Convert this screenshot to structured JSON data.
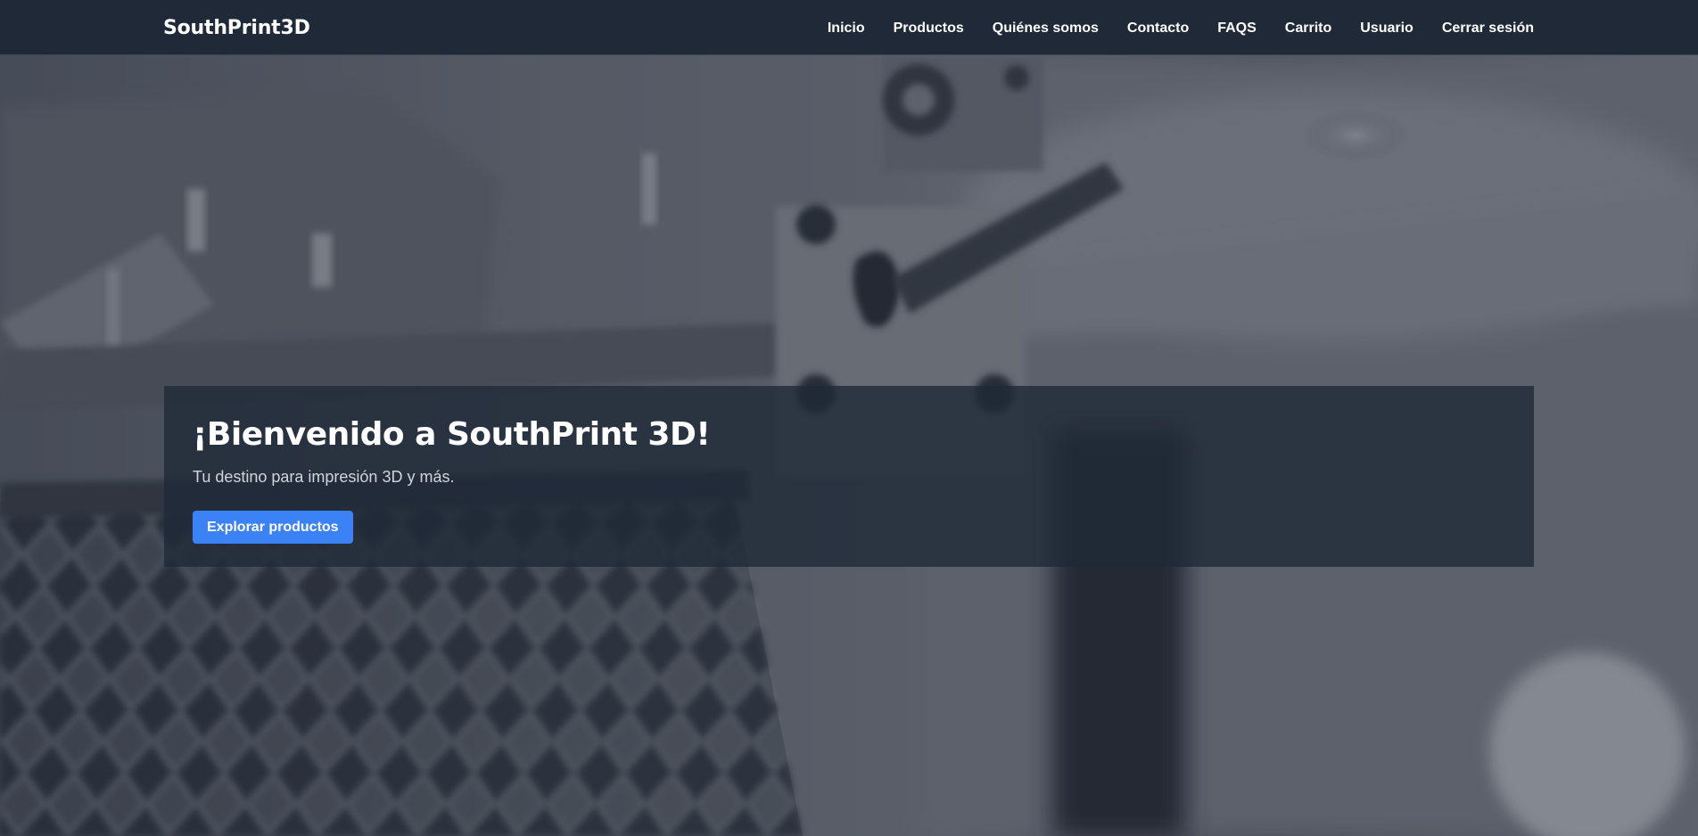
{
  "brand": {
    "name": "SouthPrint3D"
  },
  "nav": {
    "items": [
      {
        "label": "Inicio"
      },
      {
        "label": "Productos"
      },
      {
        "label": "Quiénes somos"
      },
      {
        "label": "Contacto"
      },
      {
        "label": "FAQS"
      },
      {
        "label": "Carrito"
      },
      {
        "label": "Usuario"
      },
      {
        "label": "Cerrar sesión"
      }
    ]
  },
  "hero": {
    "title": "¡Bienvenido a SouthPrint 3D!",
    "subtitle": "Tu destino para impresión 3D y más.",
    "cta_label": "Explorar productos"
  },
  "colors": {
    "navbar_bg": "#1f2937",
    "accent": "#3b82f6",
    "card_bg": "#1f2937"
  }
}
